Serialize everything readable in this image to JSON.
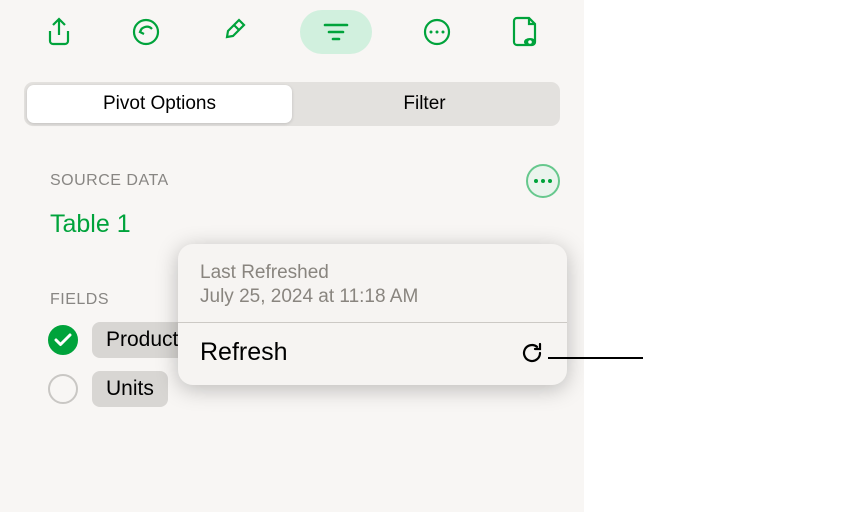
{
  "toolbar": {
    "icons": [
      "share",
      "undo",
      "format",
      "filter",
      "more",
      "comments"
    ]
  },
  "tabs": {
    "active": 0,
    "items": [
      "Pivot Options",
      "Filter"
    ]
  },
  "sourceData": {
    "label": "SOURCE DATA",
    "name": "Table 1"
  },
  "fields": {
    "label": "FIELDS",
    "items": [
      {
        "name": "Product",
        "checked": true
      },
      {
        "name": "Units",
        "checked": false
      }
    ]
  },
  "popover": {
    "lastRefreshedLabel": "Last Refreshed",
    "lastRefreshedValue": "July 25, 2024 at 11:18 AM",
    "actionLabel": "Refresh"
  }
}
